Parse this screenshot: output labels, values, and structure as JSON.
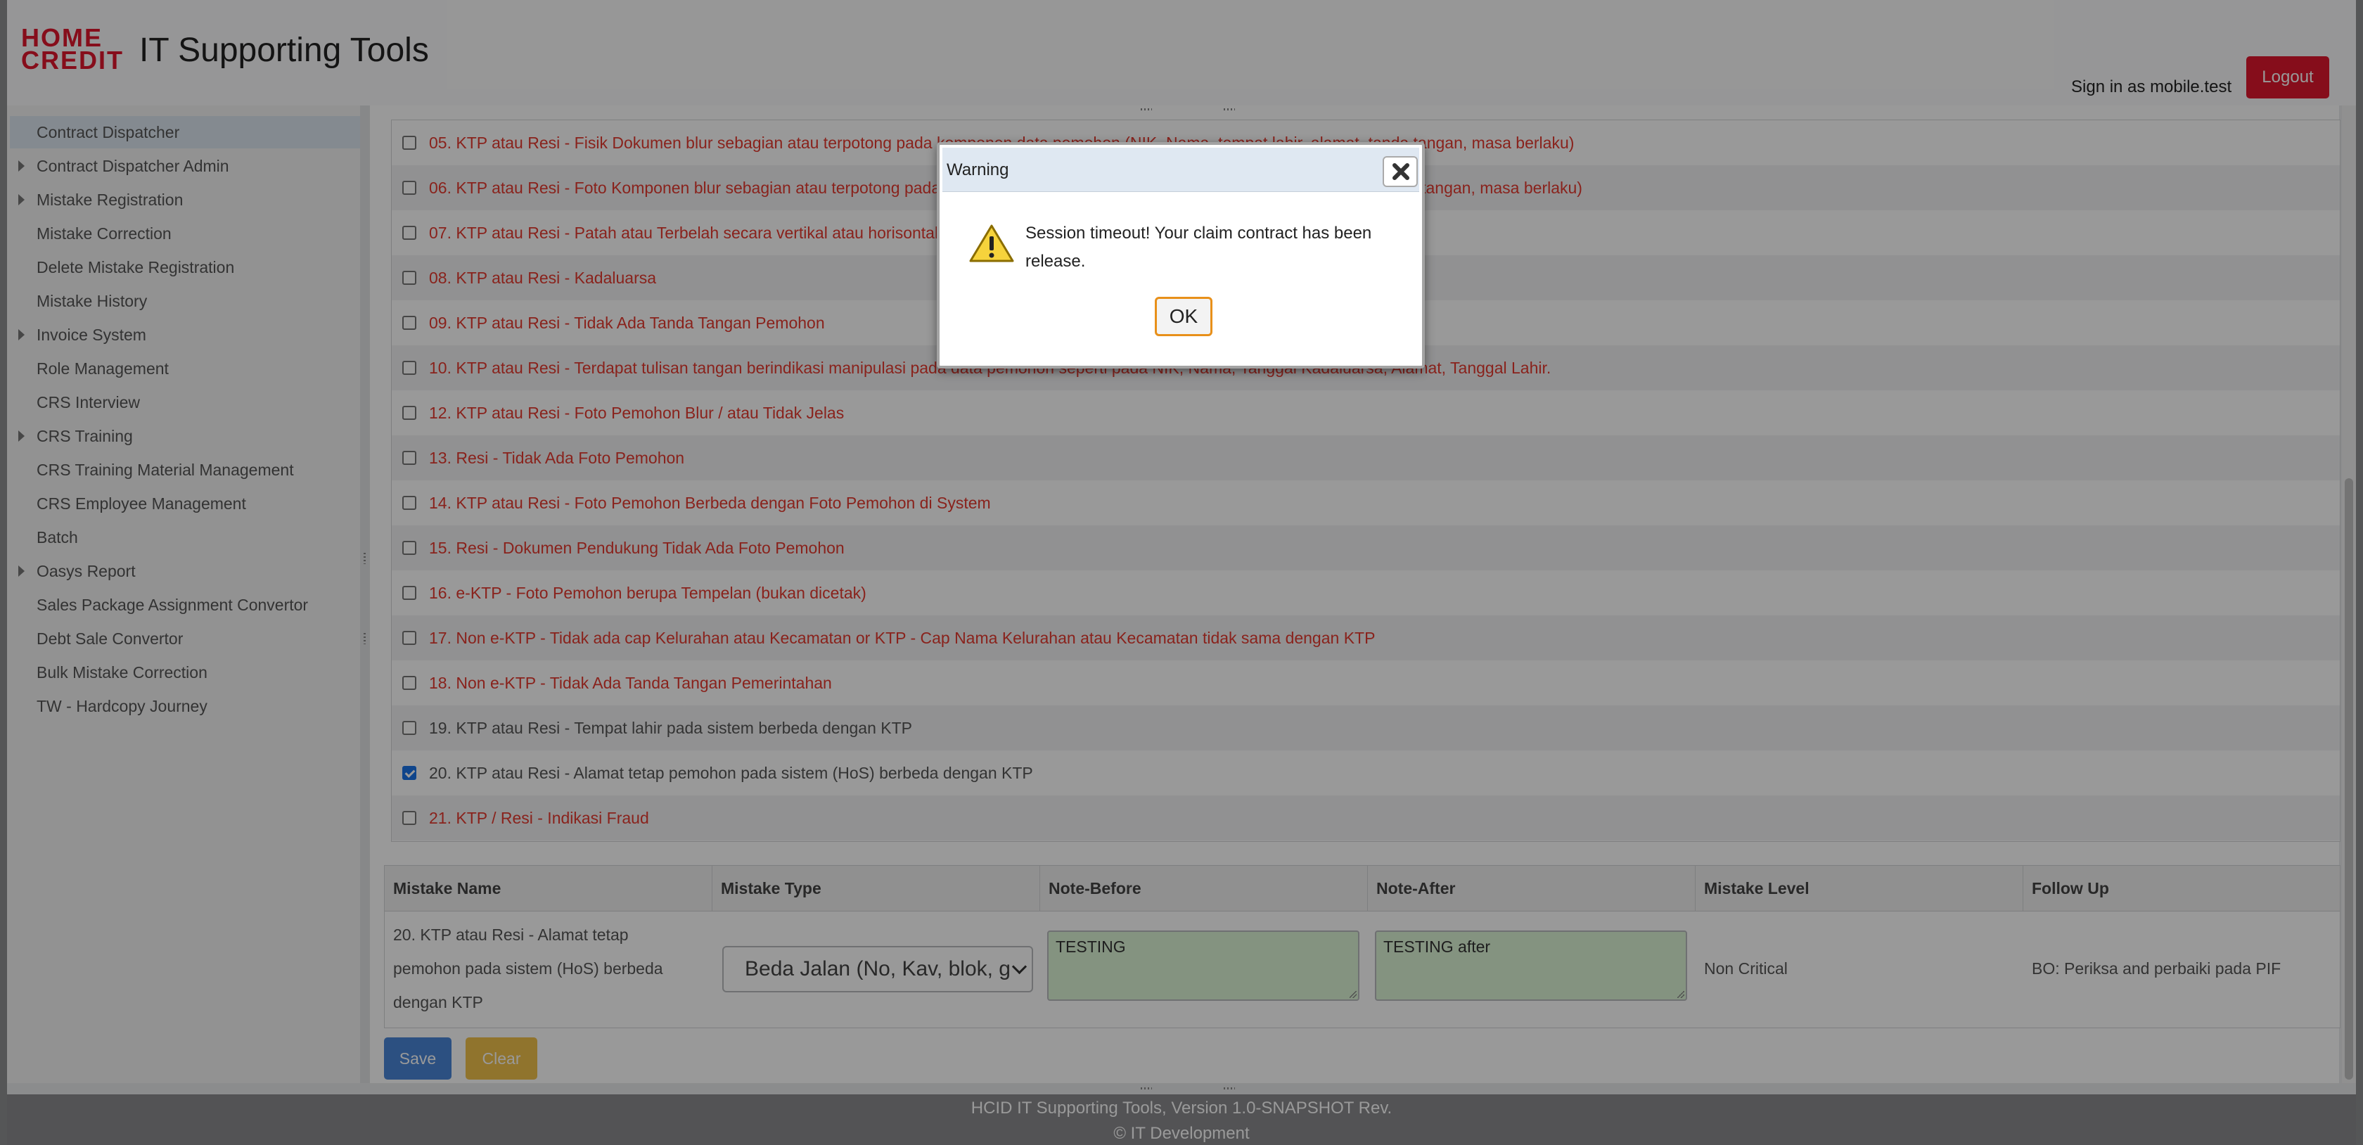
{
  "header": {
    "logo_line1": "HOME",
    "logo_line2": "CREDIT",
    "app_title": "IT Supporting Tools",
    "signin_text": "Sign in as mobile.test",
    "logout_label": "Logout"
  },
  "sidebar": {
    "items": [
      {
        "label": "Contract Dispatcher",
        "expandable": false,
        "active": true
      },
      {
        "label": "Contract Dispatcher Admin",
        "expandable": true
      },
      {
        "label": "Mistake Registration",
        "expandable": true
      },
      {
        "label": "Mistake Correction",
        "expandable": false
      },
      {
        "label": "Delete Mistake Registration",
        "expandable": false
      },
      {
        "label": "Mistake History",
        "expandable": false
      },
      {
        "label": "Invoice System",
        "expandable": true
      },
      {
        "label": "Role Management",
        "expandable": false
      },
      {
        "label": "CRS Interview",
        "expandable": false
      },
      {
        "label": "CRS Training",
        "expandable": true
      },
      {
        "label": "CRS Training Material Management",
        "expandable": false
      },
      {
        "label": "CRS Employee Management",
        "expandable": false
      },
      {
        "label": "Batch",
        "expandable": false
      },
      {
        "label": "Oasys Report",
        "expandable": true
      },
      {
        "label": "Sales Package Assignment Convertor",
        "expandable": false
      },
      {
        "label": "Debt Sale Convertor",
        "expandable": false
      },
      {
        "label": "Bulk Mistake Correction",
        "expandable": false
      },
      {
        "label": "TW - Hardcopy Journey",
        "expandable": false
      }
    ]
  },
  "checklist": {
    "items": [
      {
        "text": "05. KTP atau Resi - Fisik Dokumen blur sebagian atau terpotong pada komponen data pemohon (NIK, Nama, tempat lahir, alamat, tanda tangan, masa berlaku)",
        "checked": false,
        "red": true
      },
      {
        "text": "06. KTP atau Resi - Foto Komponen blur sebagian atau terpotong pada komponen data pemohon (NIK, Nama, tempat lahir, alamat, tanda tangan, masa berlaku)",
        "checked": false,
        "red": true
      },
      {
        "text": "07. KTP atau Resi - Patah atau Terbelah secara vertikal atau horisontal",
        "checked": false,
        "red": true
      },
      {
        "text": "08. KTP atau Resi - Kadaluarsa",
        "checked": false,
        "red": true
      },
      {
        "text": "09. KTP atau Resi - Tidak Ada Tanda Tangan Pemohon",
        "checked": false,
        "red": true
      },
      {
        "text": "10. KTP atau Resi - Terdapat tulisan tangan berindikasi manipulasi pada data pemohon seperti pada NIK, Nama, Tanggal Kadaluarsa, Alamat, Tanggal Lahir.",
        "checked": false,
        "red": true
      },
      {
        "text": "12. KTP atau Resi - Foto Pemohon Blur / atau Tidak Jelas",
        "checked": false,
        "red": true
      },
      {
        "text": "13. Resi - Tidak Ada Foto Pemohon",
        "checked": false,
        "red": true
      },
      {
        "text": "14. KTP atau Resi - Foto Pemohon Berbeda dengan Foto Pemohon di System",
        "checked": false,
        "red": true
      },
      {
        "text": "15. Resi - Dokumen Pendukung Tidak Ada Foto Pemohon",
        "checked": false,
        "red": true
      },
      {
        "text": "16. e-KTP - Foto Pemohon berupa Tempelan (bukan dicetak)",
        "checked": false,
        "red": true
      },
      {
        "text": "17. Non e-KTP - Tidak ada cap Kelurahan atau Kecamatan or KTP - Cap Nama Kelurahan atau Kecamatan tidak sama dengan KTP",
        "checked": false,
        "red": true
      },
      {
        "text": "18. Non e-KTP - Tidak Ada Tanda Tangan Pemerintahan",
        "checked": false,
        "red": true
      },
      {
        "text": "19. KTP atau Resi - Tempat lahir pada sistem berbeda dengan KTP",
        "checked": false,
        "red": false
      },
      {
        "text": "20. KTP atau Resi - Alamat tetap pemohon pada sistem (HoS) berbeda dengan KTP",
        "checked": true,
        "red": false
      },
      {
        "text": "21. KTP / Resi - Indikasi Fraud",
        "checked": false,
        "red": true
      }
    ]
  },
  "mistake_table": {
    "headers": [
      "Mistake Name",
      "Mistake Type",
      "Note-Before",
      "Note-After",
      "Mistake Level",
      "Follow Up"
    ],
    "row": {
      "name": "20. KTP atau Resi - Alamat tetap pemohon pada sistem (HoS) berbeda dengan KTP",
      "type": "Beda Jalan (No, Kav, blok, g",
      "note_before": "TESTING",
      "note_after": "TESTING after",
      "level": "Non Critical",
      "follow_up": "BO: Periksa and perbaiki pada PIF"
    }
  },
  "actions": {
    "save_label": "Save",
    "clear_label": "Clear"
  },
  "footer": {
    "version": "HCID IT Supporting Tools, Version 1.0-SNAPSHOT Rev.",
    "copyright": "© IT Development"
  },
  "dialog": {
    "title": "Warning",
    "message": "Session timeout! Your claim contract has been release.",
    "ok_label": "OK",
    "icon": "warning-icon",
    "close_icon": "close-icon"
  },
  "colors": {
    "brand": "#e0172e",
    "link_red": "#e53a2f",
    "save_blue": "#4a86d8",
    "clear_yellow": "#f0c14b",
    "note_green": "#ddf5d6",
    "ok_focus": "#e8901a"
  }
}
